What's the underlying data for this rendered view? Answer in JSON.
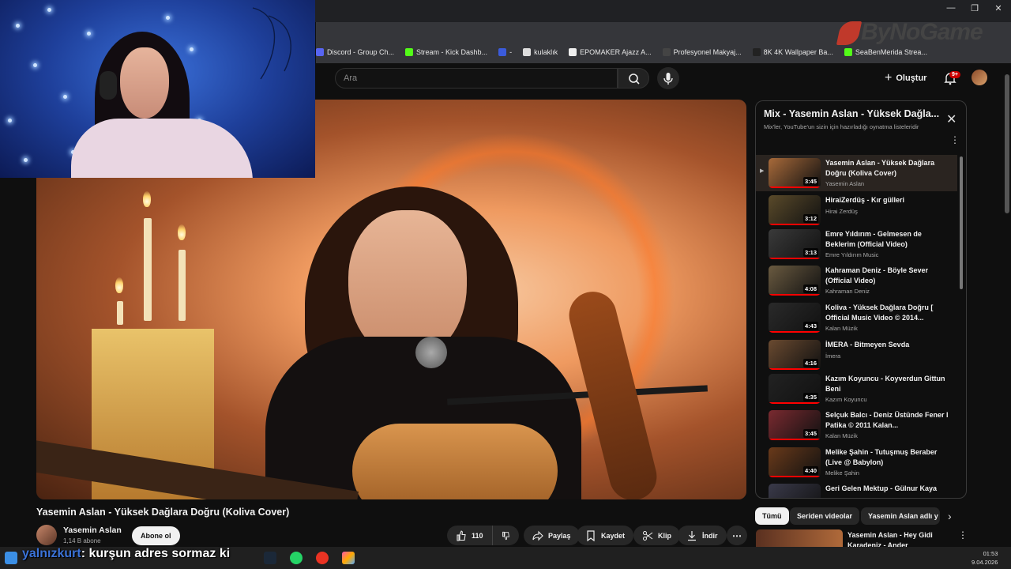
{
  "bookmarks": [
    {
      "label": "Discord - Group Ch...",
      "color": "#5865f2"
    },
    {
      "label": "Stream - Kick Dashb...",
      "color": "#53fc18"
    },
    {
      "label": "-",
      "color": "#3b5bdb"
    },
    {
      "label": "kulaklık",
      "color": "#dddddd"
    },
    {
      "label": "EPOMAKER Ajazz A...",
      "color": "#eeeeee"
    },
    {
      "label": "Profesyonel Makyaj...",
      "color": "#444444"
    },
    {
      "label": "8K 4K Wallpaper Ba...",
      "color": "#222222"
    },
    {
      "label": "SeaBenMerida Strea...",
      "color": "#53fc18"
    }
  ],
  "brand": "ByNoGame",
  "header": {
    "search_placeholder": "Ara",
    "create_label": "Oluştur",
    "notif_badge": "9+"
  },
  "video": {
    "title": "Yasemin Aslan - Yüksek Dağlara Doğru (Koliva Cover)",
    "channel": "Yasemin Aslan",
    "subscribers": "1,14 B abone",
    "subscribe_label": "Abone ol",
    "likes": "110",
    "share_label": "Paylaş",
    "save_label": "Kaydet",
    "clip_label": "Klip",
    "download_label": "İndir"
  },
  "playlist": {
    "title": "Mix - Yasemin Aslan - Yüksek Dağla...",
    "subtitle": "Mix'ler, YouTube'un sizin için hazırladığı oynatma listeleridir",
    "items": [
      {
        "title": "Yasemin Aslan - Yüksek Dağlara Doğru (Koliva Cover)",
        "channel": "Yasemin Aslan",
        "duration": "3:45",
        "active": true,
        "thumb": "#a86a3a"
      },
      {
        "title": "HiraiZerdüş - Kır gülleri",
        "channel": "Hirai Zerdüş",
        "duration": "3:12",
        "thumb": "#5a4a2a"
      },
      {
        "title": "Emre Yıldırım - Gelmesen de Beklerim (Official Video)",
        "channel": "Emre Yıldırım Music",
        "duration": "3:13",
        "thumb": "#3a3a3a"
      },
      {
        "title": "Kahraman Deniz - Böyle Sever (Official Video)",
        "channel": "Kahraman Deniz",
        "duration": "4:08",
        "thumb": "#6a5a40"
      },
      {
        "title": "Koliva - Yüksek Dağlara Doğru [ Official Music Video © 2014...",
        "channel": "Kalan Müzik",
        "duration": "4:43",
        "thumb": "#2a2a2a"
      },
      {
        "title": "İMERA - Bitmeyen Sevda",
        "channel": "İmera",
        "duration": "4:16",
        "thumb": "#6a4a30"
      },
      {
        "title": "Kazım Koyuncu - Koyverdun Gittun Beni",
        "channel": "Kazım Koyuncu",
        "duration": "4:35",
        "thumb": "#222222"
      },
      {
        "title": "Selçuk Balcı - Deniz Üstünde Fener I Patika © 2011 Kalan...",
        "channel": "Kalan Müzik",
        "duration": "3:45",
        "thumb": "#7a2a30"
      },
      {
        "title": "Melike Şahin - Tutuşmuş Beraber (Live @ Babylon)",
        "channel": "Melike Şahin",
        "duration": "4:40",
        "thumb": "#6a3a1a"
      },
      {
        "title": "Geri Gelen Mektup - Gülnur Kaya",
        "channel": "",
        "duration": "",
        "thumb": "#3a3a4a"
      }
    ]
  },
  "chips": [
    "Tümü",
    "Seriden videolar",
    "Yasemin Aslan adlı y"
  ],
  "recommendation": {
    "title": "Yasemin Aslan - Hey Gidi Karadeniz - Ander Sevdaluk..."
  },
  "overlay": {
    "highlight": "yalnızkurt",
    "text": ": kurşun adres sormaz ki"
  },
  "clock": {
    "time": "01:53",
    "date": "9.04.2026"
  }
}
